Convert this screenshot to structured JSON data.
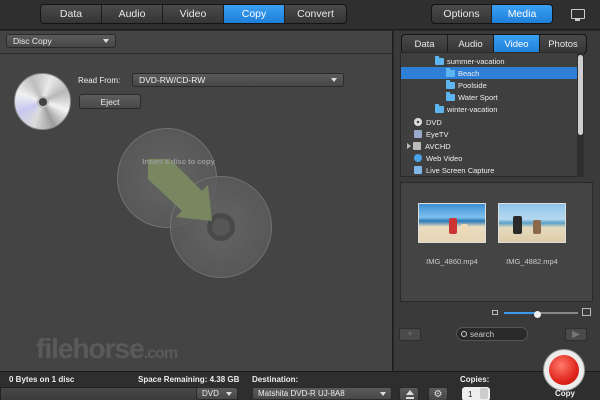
{
  "main_tabs": [
    {
      "label": "Data"
    },
    {
      "label": "Audio"
    },
    {
      "label": "Video"
    },
    {
      "label": "Copy"
    },
    {
      "label": "Convert"
    }
  ],
  "right_tabs": [
    {
      "label": "Options"
    },
    {
      "label": "Media"
    }
  ],
  "copy_panel": {
    "mode_select": "Disc Copy",
    "read_from_label": "Read From:",
    "read_from_value": "DVD-RW/CD-RW",
    "eject_label": "Eject",
    "insert_hint": "Insert a disc to copy"
  },
  "watermark": {
    "text": "filehorse",
    "suffix": ".com"
  },
  "media_tabs": [
    {
      "label": "Data"
    },
    {
      "label": "Audio"
    },
    {
      "label": "Video"
    },
    {
      "label": "Photos"
    }
  ],
  "tree": [
    {
      "label": "summer-vacation"
    },
    {
      "label": "Beach"
    },
    {
      "label": "Poolside"
    },
    {
      "label": "Water Sport"
    },
    {
      "label": "winter-vacation"
    },
    {
      "label": "DVD"
    },
    {
      "label": "EyeTV"
    },
    {
      "label": "AVCHD"
    },
    {
      "label": "Web Video"
    },
    {
      "label": "Live Screen Capture"
    }
  ],
  "thumbnails": [
    {
      "caption": "IMG_4860.mp4"
    },
    {
      "caption": "IMG_4882.mp4"
    }
  ],
  "search": {
    "placeholder": "search"
  },
  "bottom": {
    "size_text": "0 Bytes on 1 disc",
    "space_text": "Space Remaining: 4.38 GB",
    "destination_label": "Destination:",
    "media_type": "DVD",
    "destination_value": "Matshita DVD-R   UJ-8A8",
    "copies_label": "Copies:",
    "copies_value": "1",
    "copy_button_label": "Copy"
  },
  "colors": {
    "accent": "#2f7fd6",
    "record": "#e0261c"
  }
}
